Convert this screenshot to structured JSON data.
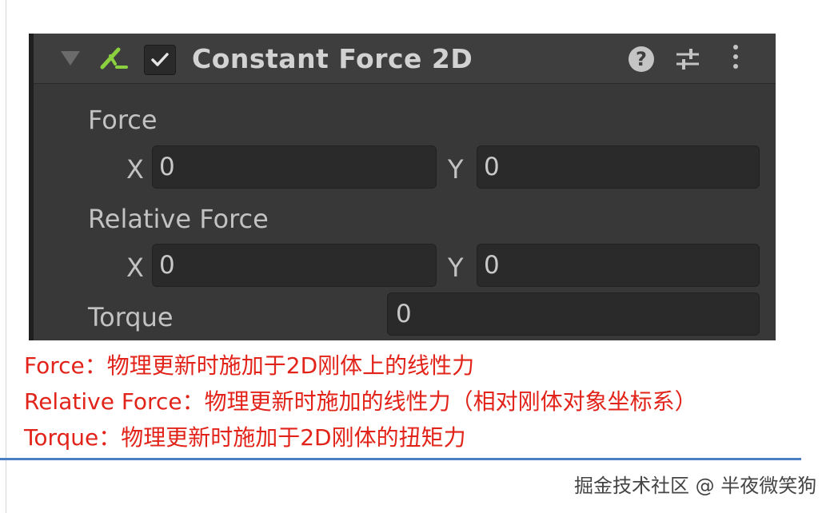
{
  "component": {
    "title": "Constant Force 2D",
    "enabled": true,
    "help_symbol": "?",
    "icons": {
      "foldout": "foldout-triangle-icon",
      "component": "constant-force-2d-icon",
      "checkbox": "checkmark-icon",
      "help": "help-icon",
      "presets": "preset-sliders-icon",
      "menu": "vertical-dots-menu-icon"
    },
    "colors": {
      "panel": "#383838",
      "header": "#3e3e3e",
      "field": "#2a2a2a",
      "component_icon": "#8bd13f"
    }
  },
  "properties": {
    "force": {
      "label": "Force",
      "x_label": "X",
      "x_value": "0",
      "y_label": "Y",
      "y_value": "0"
    },
    "relative_force": {
      "label": "Relative Force",
      "x_label": "X",
      "x_value": "0",
      "y_label": "Y",
      "y_value": "0"
    },
    "torque": {
      "label": "Torque",
      "value": "0"
    }
  },
  "annotations": [
    "Force：物理更新时施加于2D刚体上的线性力",
    "Relative Force：物理更新时施加的线性力（相对刚体对象坐标系）",
    "Torque：物理更新时施加于2D刚体的扭矩力"
  ],
  "annotation_color": "#e2231a",
  "divider_color": "#4a7fc4",
  "watermark": "掘金技术社区 @ 半夜微笑狗"
}
